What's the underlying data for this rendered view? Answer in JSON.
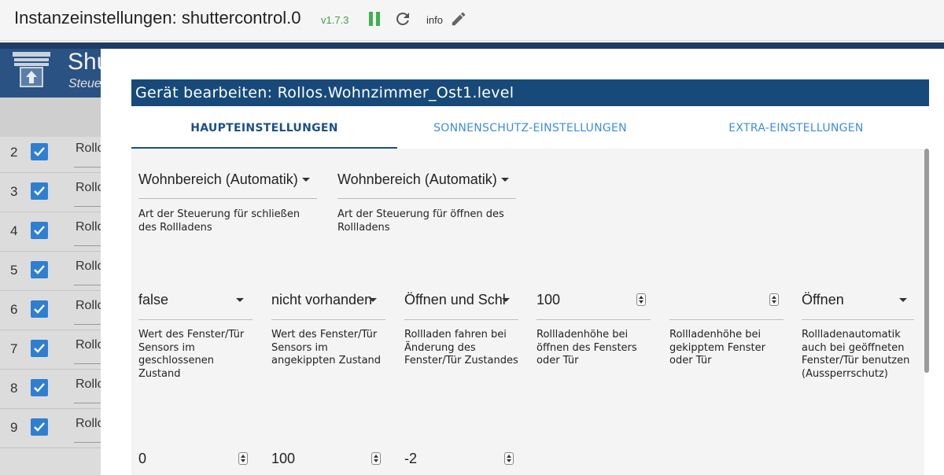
{
  "header": {
    "title": "Instanzeinstellungen: shuttercontrol.0",
    "version": "v1.7.3",
    "info_label": "info",
    "version_color": "#3aa24a"
  },
  "background_app": {
    "title_partial": "Shu",
    "subtitle_partial": "Steue",
    "rows": [
      {
        "num": "2",
        "name": "Rollo"
      },
      {
        "num": "3",
        "name": "Rollo"
      },
      {
        "num": "4",
        "name": "Rollo"
      },
      {
        "num": "5",
        "name": "Rollo"
      },
      {
        "num": "6",
        "name": "Rollo"
      },
      {
        "num": "7",
        "name": "Rollo"
      },
      {
        "num": "8",
        "name": "Rollo"
      },
      {
        "num": "9",
        "name": "Rollo"
      }
    ]
  },
  "dialog": {
    "title": "Gerät bearbeiten: Rollos.Wohnzimmer_Ost1.level",
    "tabs": [
      {
        "label": "HAUPTEINSTELLUNGEN",
        "active": true
      },
      {
        "label": "SONNENSCHUTZ-EINSTELLUNGEN",
        "active": false
      },
      {
        "label": "EXTRA-EINSTELLUNGEN",
        "active": false
      }
    ],
    "row1": [
      {
        "value": "Wohnbereich (Automatik)",
        "label": "Art der Steuerung für schließen des Rollladens"
      },
      {
        "value": "Wohnbereich (Automatik)",
        "label": "Art der Steuerung für öffnen des Rollladens"
      }
    ],
    "row2": [
      {
        "value": "false",
        "label": "Wert des Fenster/Tür Sensors im geschlossenen Zustand"
      },
      {
        "value": "nicht vorhanden",
        "label": "Wert des Fenster/Tür Sensors im angekippten Zustand"
      },
      {
        "value": "Öffnen und Schl",
        "label": "Rollladen fahren bei Änderung des Fenster/Tür Zustandes"
      },
      {
        "value": "100",
        "label": "Rollladenhöhe bei öffnen des Fensters oder Tür"
      },
      {
        "value": "",
        "label": "Rollladenhöhe bei gekipptem Fenster oder Tür"
      },
      {
        "value": "Öffnen",
        "label": "Rollladenautomatik auch bei geöffneten Fenster/Tür benutzen (Aussperrschutz)"
      }
    ],
    "row3": [
      {
        "value": "0"
      },
      {
        "value": "100"
      },
      {
        "value": "-2"
      }
    ]
  },
  "colors": {
    "dialog_title_bg": "#174a7a",
    "tab_active": "#1d4f86",
    "tab_inactive": "#3d8ed8",
    "checkbox": "#2f7fd0"
  }
}
